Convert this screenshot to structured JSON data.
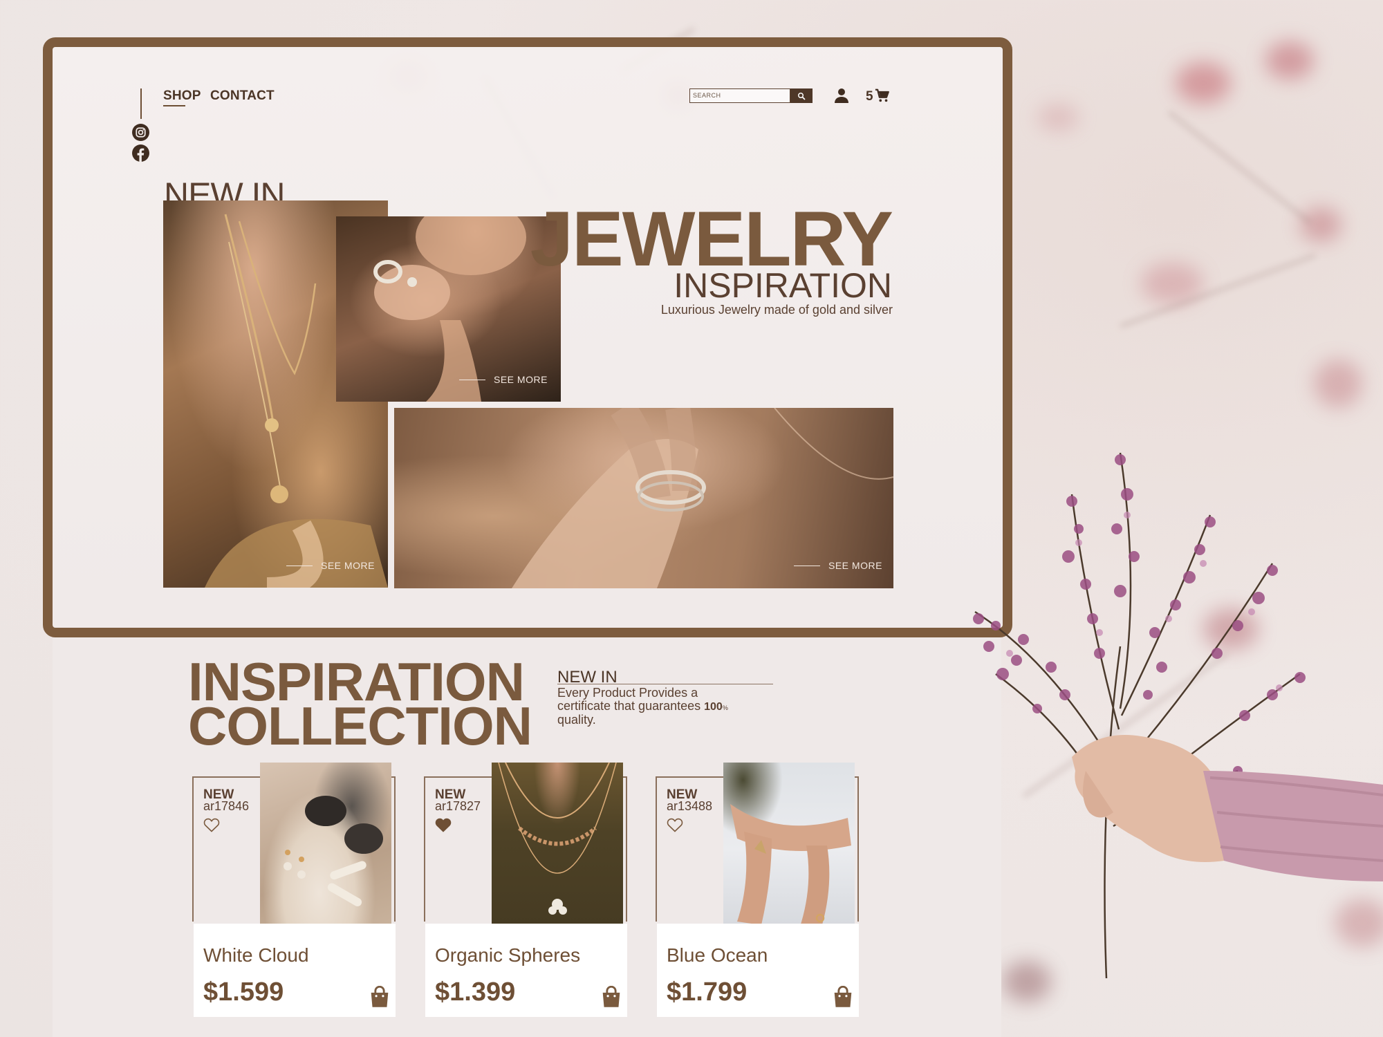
{
  "colors": {
    "brand": "#7d5c3e",
    "text_dark": "#4b3526",
    "background": "#efe9e8",
    "card_bg": "#ffffff"
  },
  "nav": {
    "links": [
      "SHOP",
      "CONTACT"
    ],
    "search_placeholder": "SEARCH",
    "cart_count": "5",
    "icons": [
      "instagram-icon",
      "facebook-icon",
      "search-icon",
      "user-icon",
      "cart-icon"
    ]
  },
  "hero": {
    "new_in": "NEW IN",
    "title": "JEWELRY",
    "subtitle": "INSPIRATION",
    "tagline": "Luxurious Jewelry made of gold and silver",
    "see_more": "SEE MORE"
  },
  "collection": {
    "title_line1": "INSPIRATION",
    "title_line2": "COLLECTION",
    "new_in": "NEW IN",
    "desc_before": "Every Product Provides a certificate that guarantees ",
    "desc_number": "100",
    "desc_unit": "%",
    "desc_after": " quality.",
    "products": [
      {
        "badge": "NEW",
        "code": "ar17846",
        "name": "White Cloud",
        "price": "$1.599",
        "favorited": false
      },
      {
        "badge": "NEW",
        "code": "ar17827",
        "name": "Organic Spheres",
        "price": "$1.399",
        "favorited": true
      },
      {
        "badge": "NEW",
        "code": "ar13488",
        "name": "Blue Ocean",
        "price": "$1.799",
        "favorited": false
      }
    ]
  }
}
